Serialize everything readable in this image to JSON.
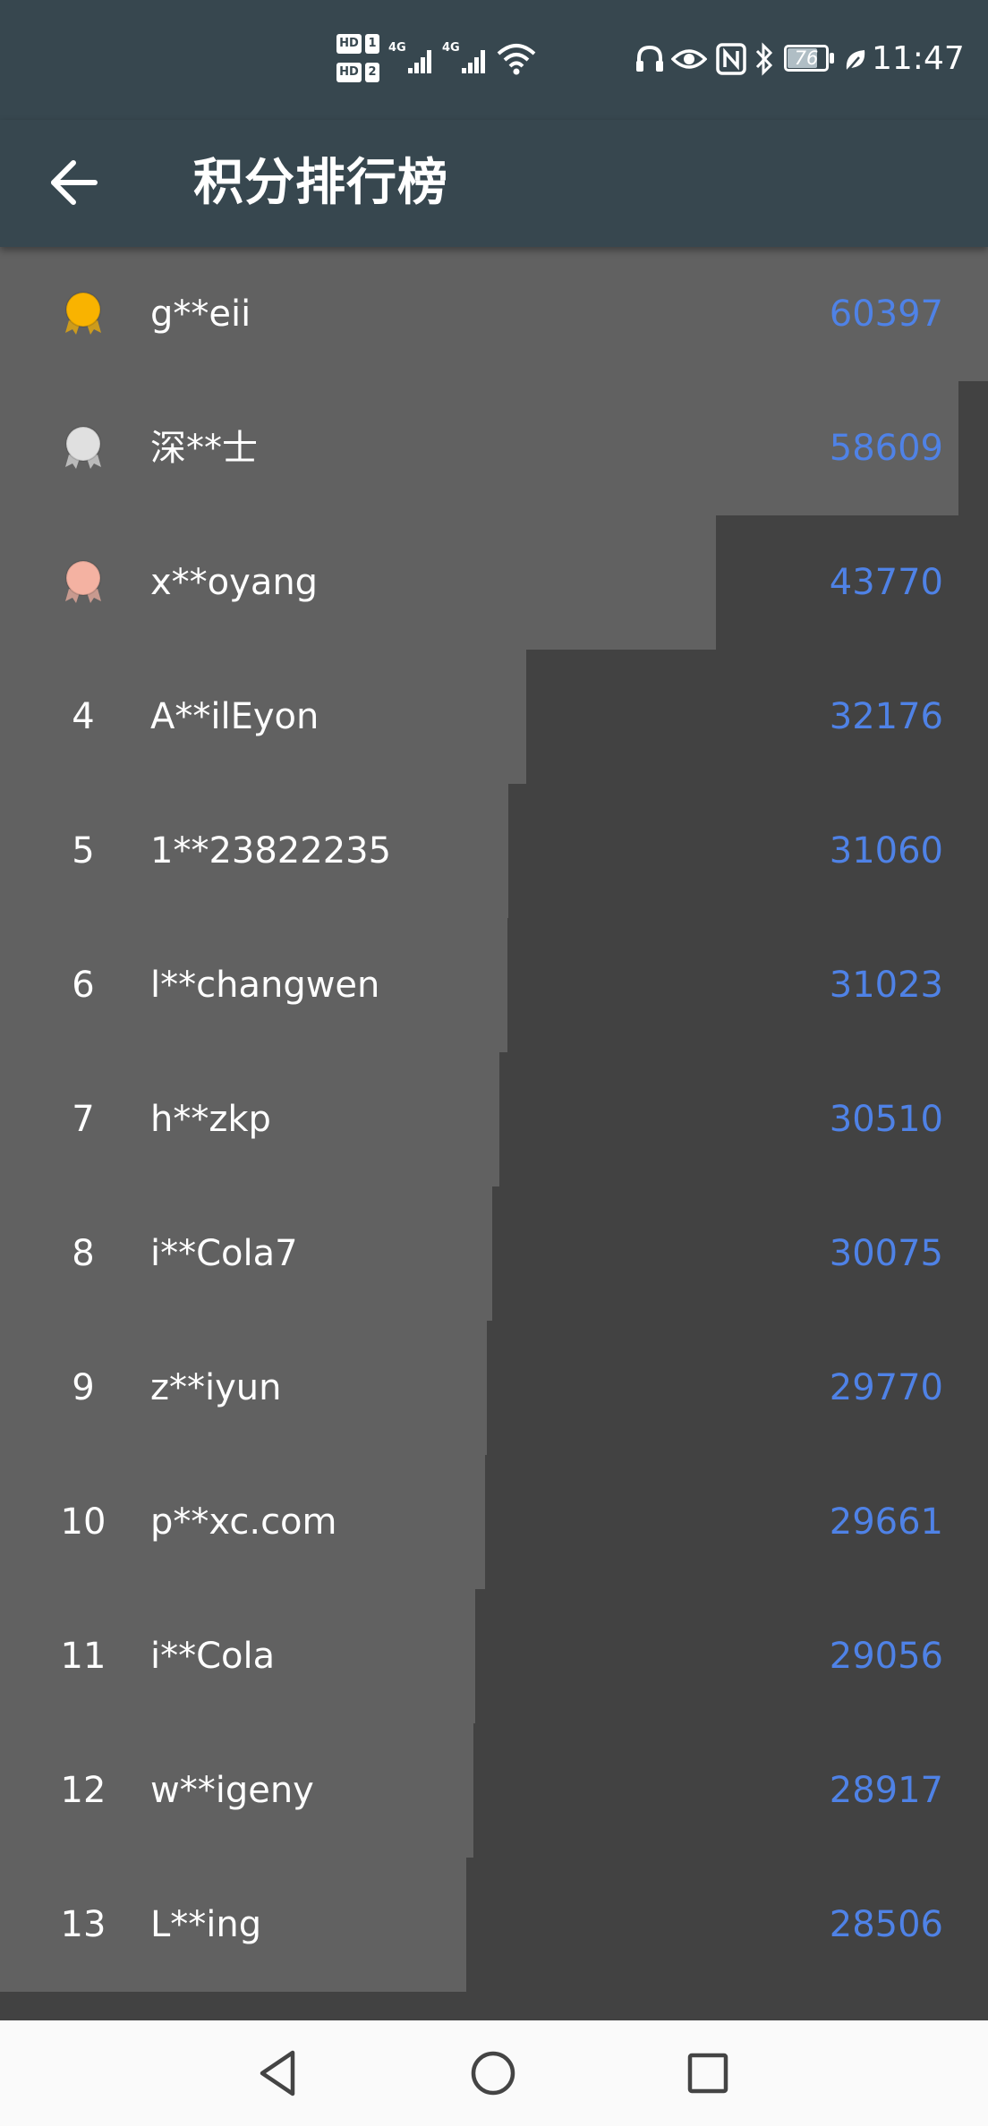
{
  "status_bar": {
    "time": "11:47",
    "battery": "76",
    "hd1": "HD",
    "hd1_sub": "1",
    "hd2": "HD",
    "hd2_sub": "2",
    "net1": "4G",
    "net2": "4G"
  },
  "app_bar": {
    "title": "积分排行榜"
  },
  "leaderboard": [
    {
      "rank": "1",
      "medal": "gold",
      "name": "g**eii",
      "score": "60397"
    },
    {
      "rank": "2",
      "medal": "silver",
      "name": "深**士",
      "score": "58609"
    },
    {
      "rank": "3",
      "medal": "bronze",
      "name": "x**oyang",
      "score": "43770"
    },
    {
      "rank": "4",
      "medal": "",
      "name": "A**ilEyon",
      "score": "32176"
    },
    {
      "rank": "5",
      "medal": "",
      "name": "1**23822235",
      "score": "31060"
    },
    {
      "rank": "6",
      "medal": "",
      "name": "l**changwen",
      "score": "31023"
    },
    {
      "rank": "7",
      "medal": "",
      "name": "h**zkp",
      "score": "30510"
    },
    {
      "rank": "8",
      "medal": "",
      "name": "i**Cola7",
      "score": "30075"
    },
    {
      "rank": "9",
      "medal": "",
      "name": "z**iyun",
      "score": "29770"
    },
    {
      "rank": "10",
      "medal": "",
      "name": "p**xc.com",
      "score": "29661"
    },
    {
      "rank": "11",
      "medal": "",
      "name": "i**Cola",
      "score": "29056"
    },
    {
      "rank": "12",
      "medal": "",
      "name": "w**igeny",
      "score": "28917"
    },
    {
      "rank": "13",
      "medal": "",
      "name": "L**ing",
      "score": "28506"
    }
  ],
  "colors": {
    "app_bar": "#37474f",
    "score": "#4f82e6",
    "bar": "#616161",
    "track": "#424242",
    "gold": "#f9b300",
    "silver": "#e0e0e0",
    "bronze": "#f4b2a2"
  }
}
